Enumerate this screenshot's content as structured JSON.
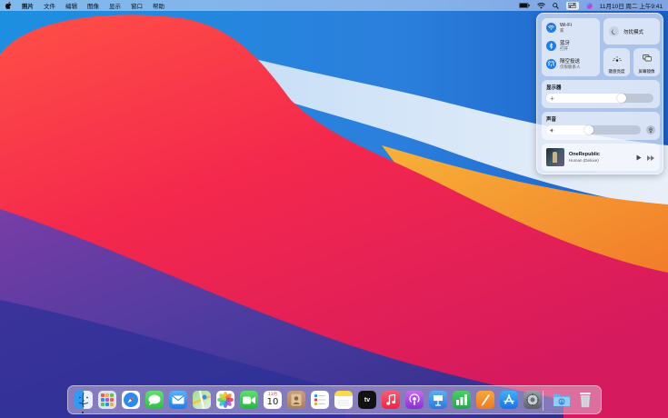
{
  "menubar": {
    "app_name": "照片",
    "menus": [
      "文件",
      "编辑",
      "图像",
      "显示",
      "窗口",
      "帮助"
    ],
    "datetime": "11月10日 周二 上午9:41"
  },
  "control_center": {
    "wifi": {
      "title": "Wi-Fi",
      "subtitle": "家"
    },
    "bluetooth": {
      "title": "蓝牙",
      "subtitle": "打开"
    },
    "airdrop": {
      "title": "隔空投送",
      "subtitle": "仅限联系人"
    },
    "dnd": {
      "label": "勿扰模式"
    },
    "keyboard_brightness": {
      "label": "键盘亮度"
    },
    "screen_mirroring": {
      "label": "屏幕镜像"
    },
    "display": {
      "label": "显示器",
      "level": 0.72
    },
    "sound": {
      "label": "声音",
      "level": 0.45
    },
    "now_playing": {
      "artist": "OneRepublic",
      "album": "Human (Deluxe)"
    }
  },
  "dock": {
    "calendar_month": "11月",
    "calendar_day": "10",
    "apps": [
      "finder",
      "launchpad",
      "safari",
      "messages",
      "mail",
      "maps",
      "photos",
      "facetime",
      "calendar",
      "contacts",
      "reminders",
      "notes",
      "tv",
      "music",
      "podcasts",
      "keynote",
      "numbers",
      "pages",
      "app-store",
      "system-preferences",
      "downloads",
      "trash"
    ]
  },
  "colors": {
    "accent": "#1a7cf0",
    "wallpaper_red": "#f0284a",
    "wallpaper_blue": "#2e7fd6",
    "wallpaper_orange": "#f7a32a"
  }
}
